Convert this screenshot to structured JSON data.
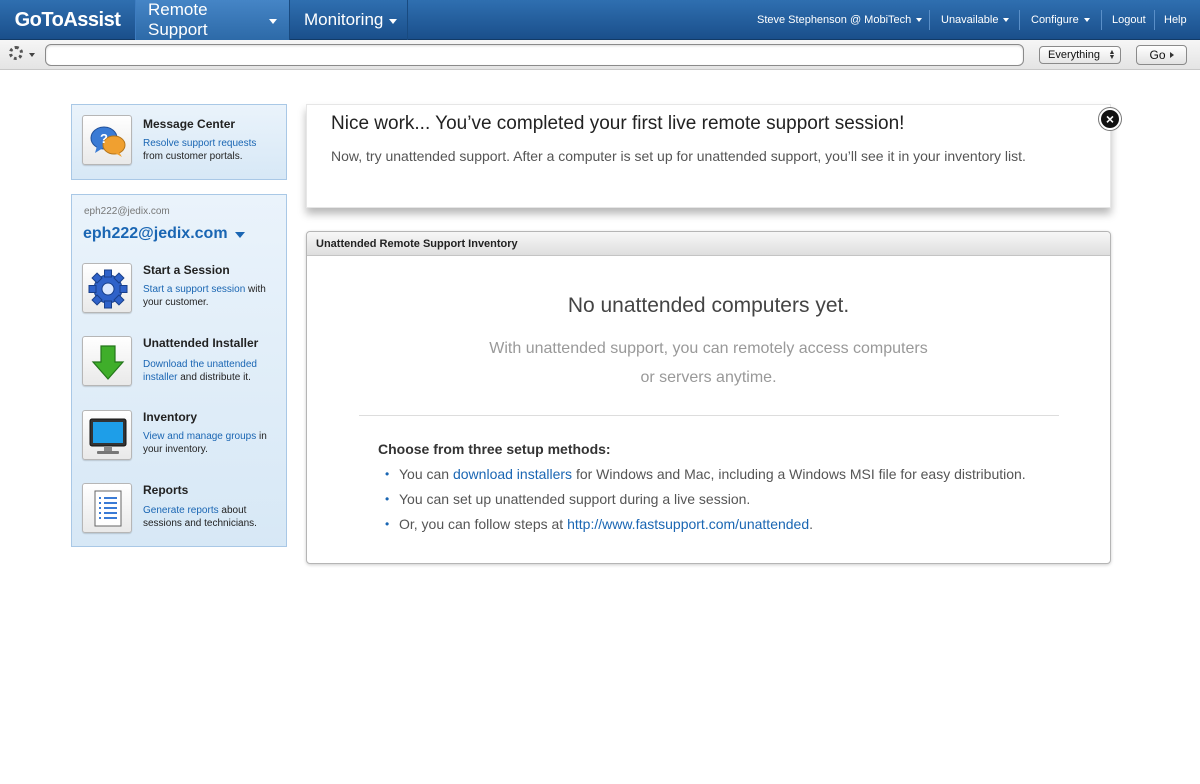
{
  "nav": {
    "logo": "GoToAssist",
    "tabs": [
      {
        "label": "Remote Support"
      },
      {
        "label": "Monitoring"
      }
    ],
    "user": "Steve Stephenson @ MobiTech",
    "status": "Unavailable",
    "configure": "Configure",
    "logout": "Logout",
    "help": "Help"
  },
  "search": {
    "value": "",
    "placeholder": "",
    "scope": "Everything",
    "go_label": "Go"
  },
  "sidebar": {
    "message_center": {
      "title": "Message Center",
      "link": "Resolve support requests",
      "rest": "from customer portals."
    },
    "account": {
      "email_small": "eph222@jedix.com",
      "email_big": "eph222@jedix.com"
    },
    "items": [
      {
        "title": "Start a Session",
        "link": "Start a support session",
        "rest": " with your customer."
      },
      {
        "title": "Unattended Installer",
        "link": "Download the unattended installer",
        "rest": " and distribute it."
      },
      {
        "title": "Inventory",
        "link": "View and manage groups",
        "rest": " in your inventory."
      },
      {
        "title": "Reports",
        "link": "Generate reports",
        "rest": " about sessions and technicians."
      }
    ]
  },
  "notice": {
    "title": "Nice work... You’ve completed your first live remote support session!",
    "body": "Now, try unattended support. After a computer is set up for unattended support, you’ll see it in your inventory list.",
    "close": "×"
  },
  "inventory": {
    "header": "Unattended Remote Support Inventory",
    "empty_title": "No unattended computers yet.",
    "empty_sub": "With unattended support, you can remotely access computers or servers anytime.",
    "methods_title": "Choose from three setup methods:",
    "methods": [
      {
        "pre": "You can ",
        "link": "download installers",
        "post": " for Windows and Mac, including a Windows MSI file for easy distribution."
      },
      {
        "pre": "You can set up unattended support during a live session.",
        "link": "",
        "post": ""
      },
      {
        "pre": "Or, you can follow steps at ",
        "link": "http://www.fastsupport.com/unattended",
        "post": "."
      }
    ]
  },
  "colors": {
    "nav_blue": "#1a4f8b",
    "link_blue": "#1a66b3",
    "panel_blue": "#d7e8f6"
  }
}
